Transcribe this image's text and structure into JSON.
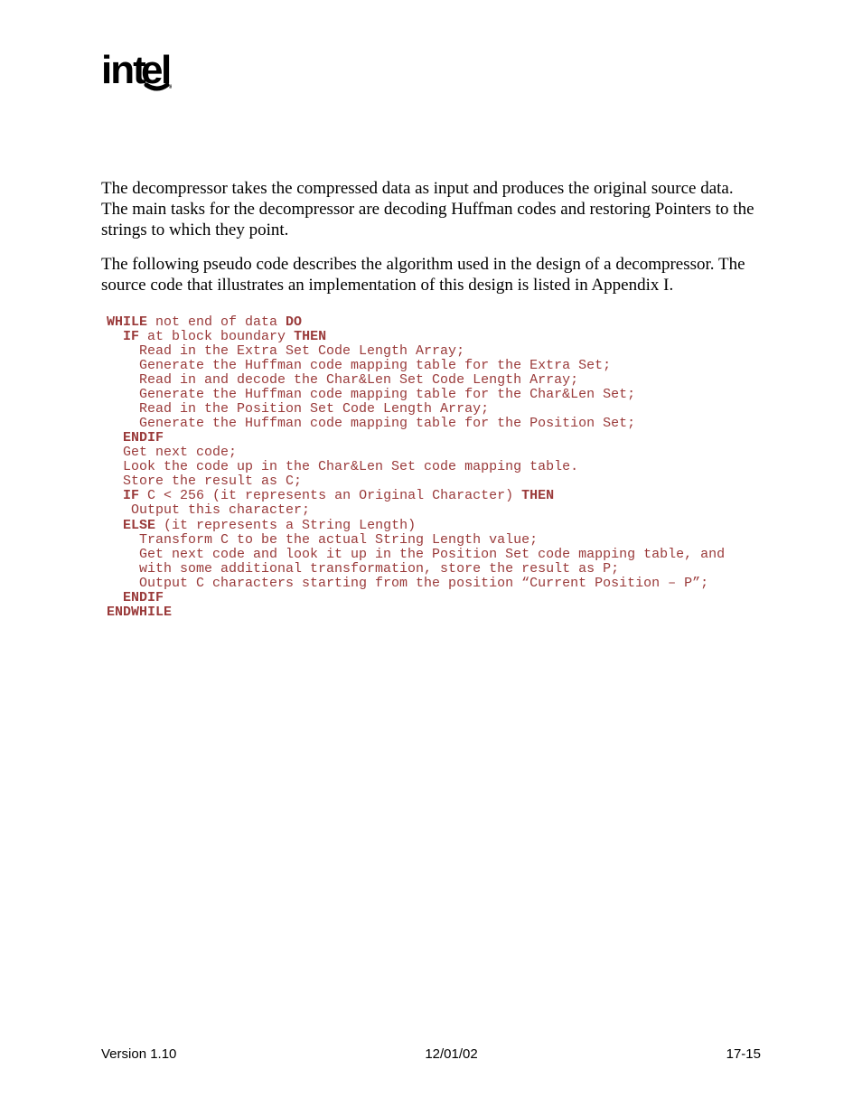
{
  "logo": {
    "text": "intel",
    "subscript": "®"
  },
  "para1": "The decompressor takes the compressed data as input and produces the original source data.  The main tasks for the decompressor are decoding Huffman codes and restoring Pointers to the strings to which they point.",
  "para2": "The following pseudo code describes the algorithm used in the design of a decompressor.  The source code that illustrates an implementation of this design is listed in Appendix I.",
  "code": {
    "kw_while": "WHILE",
    "l0_rest": " not end of data ",
    "kw_do": "DO",
    "kw_if1": "IF",
    "l1_rest": " at block boundary ",
    "kw_then1": "THEN",
    "l2": "    Read in the Extra Set Code Length Array;",
    "l3": "    Generate the Huffman code mapping table for the Extra Set;",
    "l4": "    Read in and decode the Char&Len Set Code Length Array;",
    "l5": "    Generate the Huffman code mapping table for the Char&Len Set;",
    "l6": "    Read in the Position Set Code Length Array;",
    "l7": "    Generate the Huffman code mapping table for the Position Set;",
    "kw_endif1": "ENDIF",
    "l8": "  Get next code;",
    "l9": "  Look the code up in the Char&Len Set code mapping table.",
    "l10": "  Store the result as C;",
    "kw_if2": "IF",
    "l11_rest": " C < 256 (it represents an Original Character) ",
    "kw_then2": "THEN",
    "l12": "   Output this character;",
    "kw_else": "ELSE",
    "l13_rest": " (it represents a String Length)",
    "l14": "    Transform C to be the actual String Length value;",
    "l15": "    Get next code and look it up in the Position Set code mapping table, and",
    "l16": "    with some additional transformation, store the result as P;",
    "l17": "    Output C characters starting from the position “Current Position – P”;",
    "kw_endif2": "ENDIF",
    "kw_endwhile": "ENDWHILE"
  },
  "footer": {
    "version": "Version 1.10",
    "date": "12/01/02",
    "page": "17-15"
  }
}
